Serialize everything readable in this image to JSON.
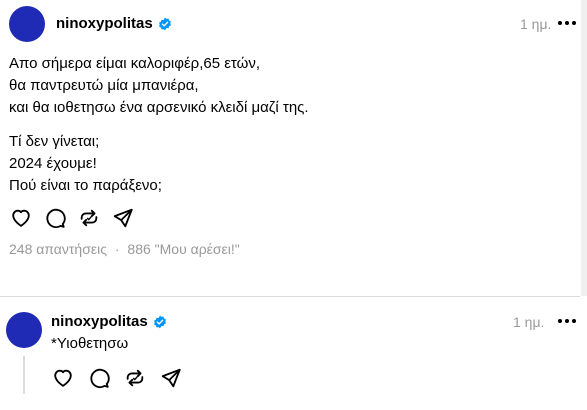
{
  "post": {
    "username": "ninoxypolitas",
    "time": "1 ημ.",
    "lines": [
      "Απο σήμερα είμαι καλοριφέρ,65 ετών,",
      "θα παντρευτώ μία μπανιέρα,",
      "και θα ιοθετησω ένα αρσενικό κλειδί μαζί της."
    ],
    "lines2": [
      "Τί δεν γίνεται;",
      "2024 έχουμε!",
      "Πού είναι το παράξενο;"
    ],
    "replies_text": "248 απαντήσεις",
    "separator": "·",
    "likes_text": "886 \"Μου αρέσει!\""
  },
  "reply": {
    "username": "ninoxypolitas",
    "time": "1 ημ.",
    "text": "*Υιοθετησω"
  },
  "icons": [
    "verified-badge-icon",
    "more-icon",
    "heart-icon",
    "comment-icon",
    "repost-icon",
    "share-icon"
  ],
  "colors": {
    "avatar": "#1f2bb5",
    "verified": "#0095f6",
    "muted": "#999999"
  }
}
